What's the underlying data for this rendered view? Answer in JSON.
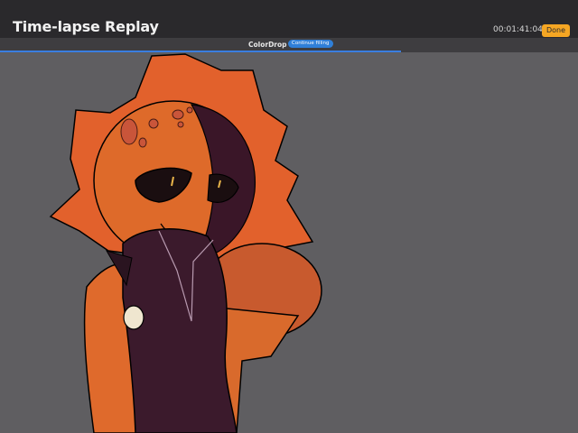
{
  "header": {
    "title": "Time-lapse Replay",
    "elapsed_time": "00:01:41:04",
    "done_label": "Done"
  },
  "status": {
    "tool_name": "ColorDrop",
    "action_label": "Continue filling"
  },
  "playback": {
    "progress_fraction": 0.694
  },
  "colors": {
    "accent_done": "#f5a623",
    "accent_progress": "#3a7ee0",
    "canvas_background": "#5f5e61",
    "topbar": "#2a292c"
  }
}
